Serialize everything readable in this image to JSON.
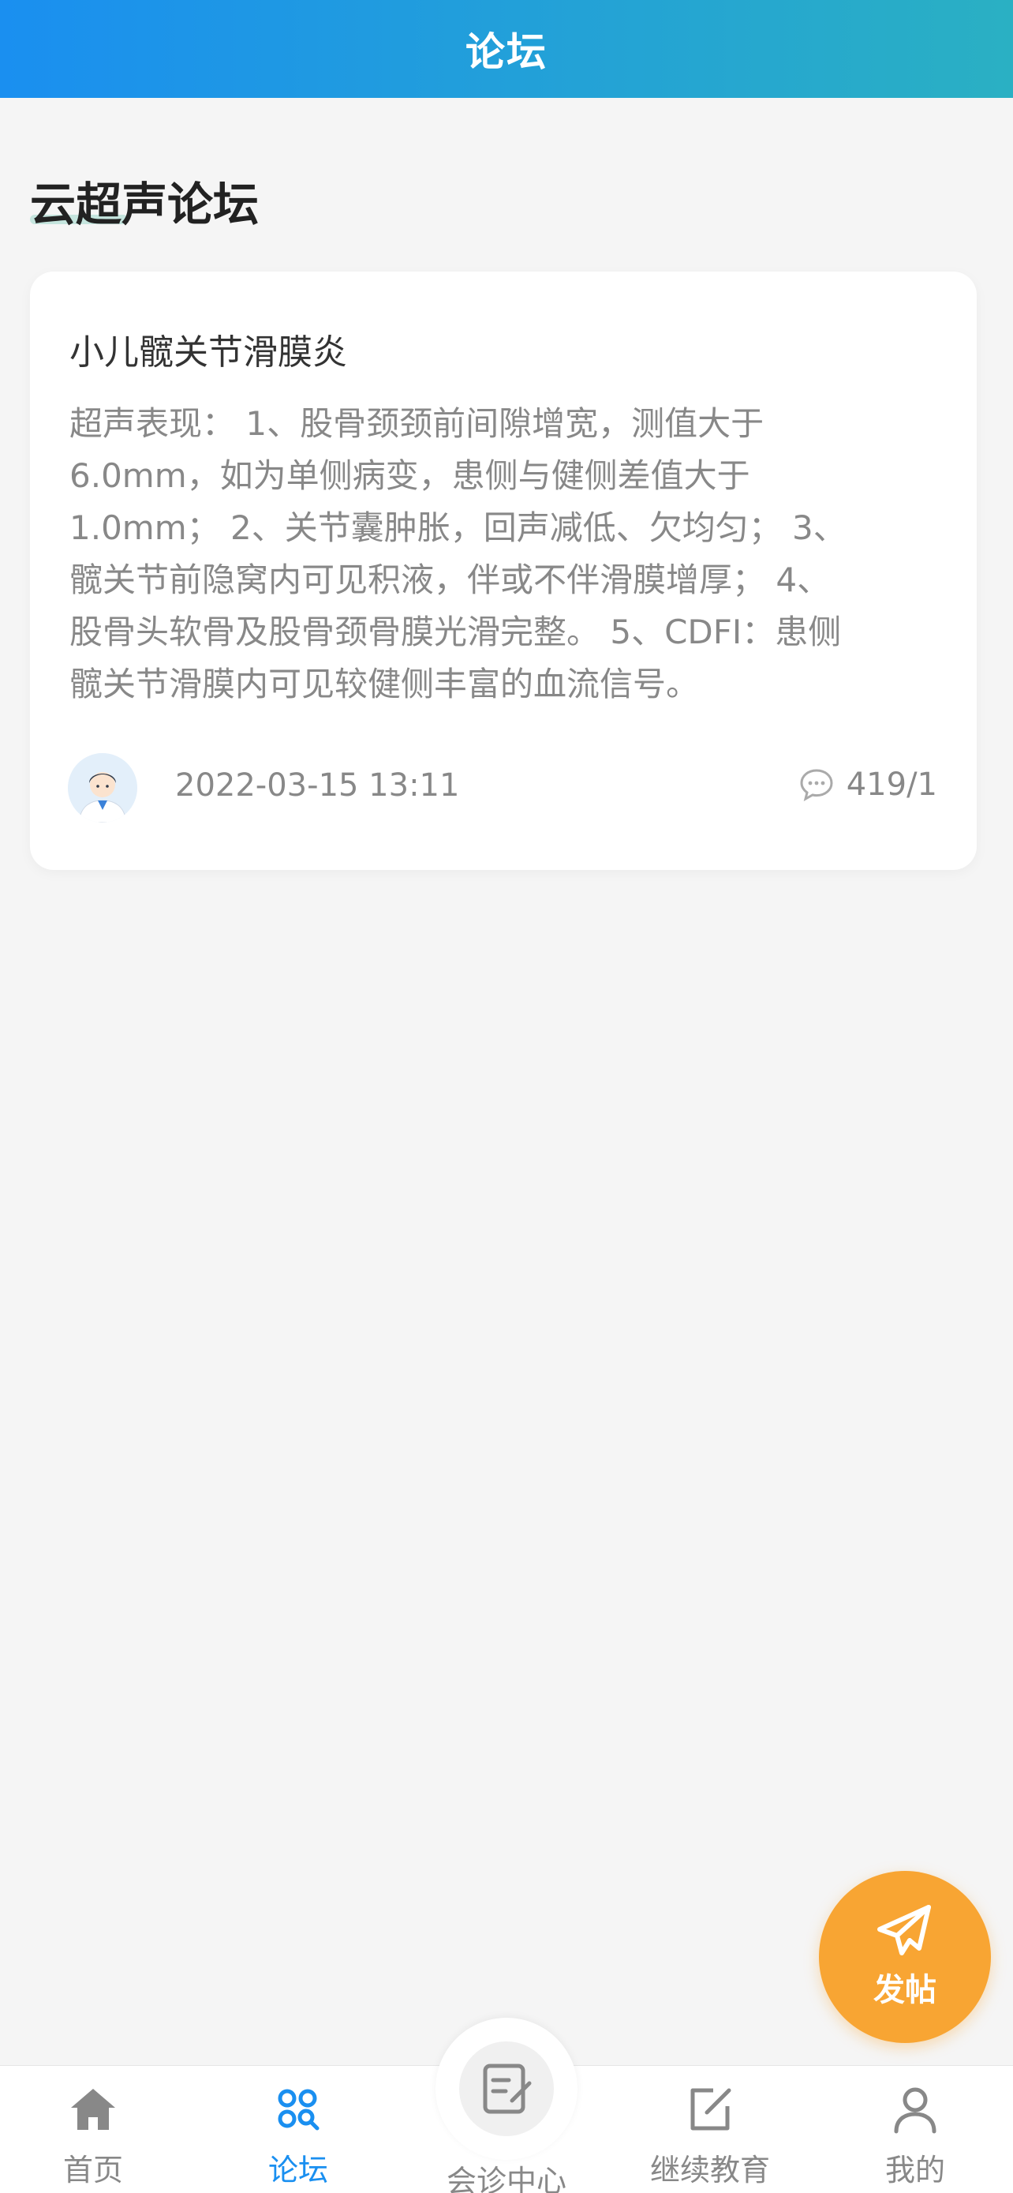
{
  "header": {
    "title": "论坛"
  },
  "section": {
    "title": "云超声论坛"
  },
  "post": {
    "title": "小儿髋关节滑膜炎",
    "body_lines": [
      "超声表现： 1、股骨颈颈前间隙增宽，测值大于",
      "6.0mm，如为单侧病变，患侧与健侧差值大于",
      "1.0mm； 2、关节囊肿胀，回声减低、欠均匀； 3、",
      "髋关节前隐窝内可见积液，伴或不伴滑膜增厚； 4、",
      "股骨头软骨及股骨颈骨膜光滑完整。 5、CDFI：患侧",
      "髋关节滑膜内可见较健侧丰富的血流信号。"
    ],
    "time": "2022-03-15 13:11",
    "comment_count": "419/1"
  },
  "fab": {
    "label": "发帖",
    "color": "#f8a533"
  },
  "tabbar": {
    "items": [
      {
        "label": "首页",
        "icon": "home-icon"
      },
      {
        "label": "论坛",
        "icon": "forum-icon",
        "active": true
      },
      {
        "label": "会诊中心",
        "icon": "consult-icon"
      },
      {
        "label": "继续教育",
        "icon": "edit-icon"
      },
      {
        "label": "我的",
        "icon": "user-icon"
      }
    ]
  },
  "colors": {
    "accent": "#1a8ff0",
    "header_end": "#2ab0c3",
    "muted": "#888888"
  }
}
